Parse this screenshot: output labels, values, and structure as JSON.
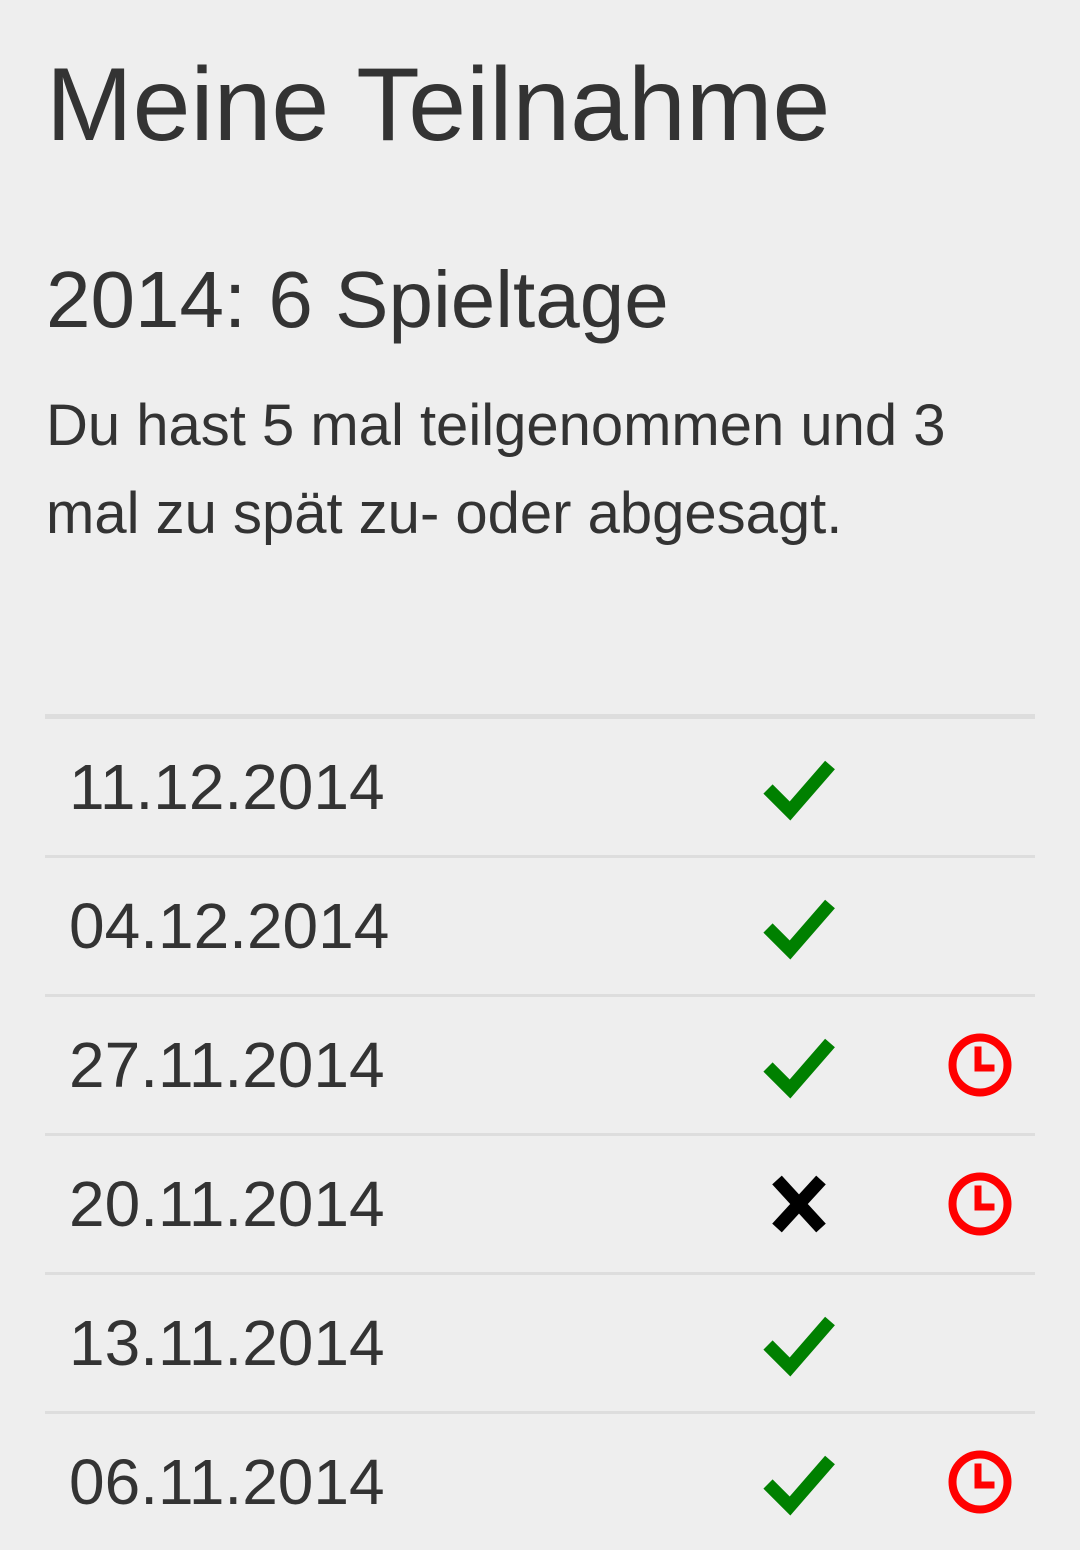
{
  "page": {
    "title": "Meine Teilnahme"
  },
  "season": {
    "heading": "2014: 6 Spieltage",
    "summary": "Du hast 5 mal teilgenommen und 3 mal zu spät zu- oder abgesagt."
  },
  "colors": {
    "background": "#eeeeee",
    "text": "#333333",
    "participated": "#008000",
    "not_participated": "#000000",
    "late": "#ff0000",
    "divider": "#dddddd"
  },
  "icons": {
    "participated": "check-icon",
    "not_participated": "x-icon",
    "late": "clock-icon"
  },
  "matchdays": [
    {
      "date": "11.12.2014",
      "participated": true,
      "late": false
    },
    {
      "date": "04.12.2014",
      "participated": true,
      "late": false
    },
    {
      "date": "27.11.2014",
      "participated": true,
      "late": true
    },
    {
      "date": "20.11.2014",
      "participated": false,
      "late": true
    },
    {
      "date": "13.11.2014",
      "participated": true,
      "late": false
    },
    {
      "date": "06.11.2014",
      "participated": true,
      "late": true
    }
  ]
}
